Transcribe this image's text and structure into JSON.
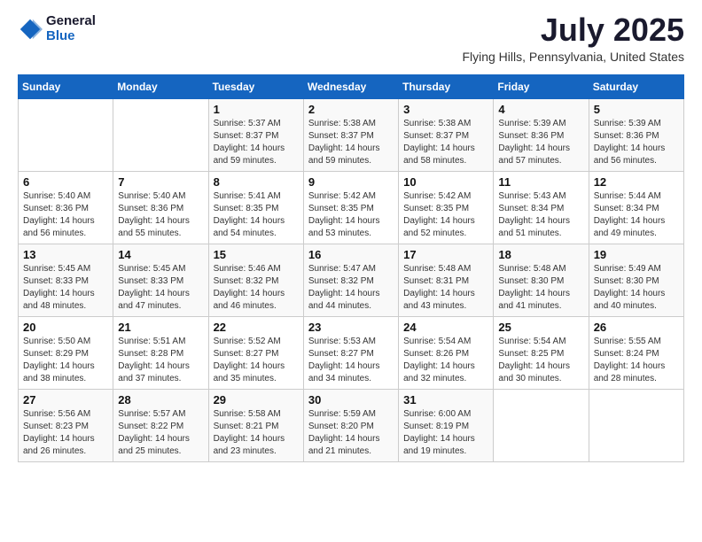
{
  "header": {
    "logo_general": "General",
    "logo_blue": "Blue",
    "month_year": "July 2025",
    "location": "Flying Hills, Pennsylvania, United States"
  },
  "weekdays": [
    "Sunday",
    "Monday",
    "Tuesday",
    "Wednesday",
    "Thursday",
    "Friday",
    "Saturday"
  ],
  "weeks": [
    [
      {
        "day": "",
        "content": ""
      },
      {
        "day": "",
        "content": ""
      },
      {
        "day": "1",
        "content": "Sunrise: 5:37 AM\nSunset: 8:37 PM\nDaylight: 14 hours and 59 minutes."
      },
      {
        "day": "2",
        "content": "Sunrise: 5:38 AM\nSunset: 8:37 PM\nDaylight: 14 hours and 59 minutes."
      },
      {
        "day": "3",
        "content": "Sunrise: 5:38 AM\nSunset: 8:37 PM\nDaylight: 14 hours and 58 minutes."
      },
      {
        "day": "4",
        "content": "Sunrise: 5:39 AM\nSunset: 8:36 PM\nDaylight: 14 hours and 57 minutes."
      },
      {
        "day": "5",
        "content": "Sunrise: 5:39 AM\nSunset: 8:36 PM\nDaylight: 14 hours and 56 minutes."
      }
    ],
    [
      {
        "day": "6",
        "content": "Sunrise: 5:40 AM\nSunset: 8:36 PM\nDaylight: 14 hours and 56 minutes."
      },
      {
        "day": "7",
        "content": "Sunrise: 5:40 AM\nSunset: 8:36 PM\nDaylight: 14 hours and 55 minutes."
      },
      {
        "day": "8",
        "content": "Sunrise: 5:41 AM\nSunset: 8:35 PM\nDaylight: 14 hours and 54 minutes."
      },
      {
        "day": "9",
        "content": "Sunrise: 5:42 AM\nSunset: 8:35 PM\nDaylight: 14 hours and 53 minutes."
      },
      {
        "day": "10",
        "content": "Sunrise: 5:42 AM\nSunset: 8:35 PM\nDaylight: 14 hours and 52 minutes."
      },
      {
        "day": "11",
        "content": "Sunrise: 5:43 AM\nSunset: 8:34 PM\nDaylight: 14 hours and 51 minutes."
      },
      {
        "day": "12",
        "content": "Sunrise: 5:44 AM\nSunset: 8:34 PM\nDaylight: 14 hours and 49 minutes."
      }
    ],
    [
      {
        "day": "13",
        "content": "Sunrise: 5:45 AM\nSunset: 8:33 PM\nDaylight: 14 hours and 48 minutes."
      },
      {
        "day": "14",
        "content": "Sunrise: 5:45 AM\nSunset: 8:33 PM\nDaylight: 14 hours and 47 minutes."
      },
      {
        "day": "15",
        "content": "Sunrise: 5:46 AM\nSunset: 8:32 PM\nDaylight: 14 hours and 46 minutes."
      },
      {
        "day": "16",
        "content": "Sunrise: 5:47 AM\nSunset: 8:32 PM\nDaylight: 14 hours and 44 minutes."
      },
      {
        "day": "17",
        "content": "Sunrise: 5:48 AM\nSunset: 8:31 PM\nDaylight: 14 hours and 43 minutes."
      },
      {
        "day": "18",
        "content": "Sunrise: 5:48 AM\nSunset: 8:30 PM\nDaylight: 14 hours and 41 minutes."
      },
      {
        "day": "19",
        "content": "Sunrise: 5:49 AM\nSunset: 8:30 PM\nDaylight: 14 hours and 40 minutes."
      }
    ],
    [
      {
        "day": "20",
        "content": "Sunrise: 5:50 AM\nSunset: 8:29 PM\nDaylight: 14 hours and 38 minutes."
      },
      {
        "day": "21",
        "content": "Sunrise: 5:51 AM\nSunset: 8:28 PM\nDaylight: 14 hours and 37 minutes."
      },
      {
        "day": "22",
        "content": "Sunrise: 5:52 AM\nSunset: 8:27 PM\nDaylight: 14 hours and 35 minutes."
      },
      {
        "day": "23",
        "content": "Sunrise: 5:53 AM\nSunset: 8:27 PM\nDaylight: 14 hours and 34 minutes."
      },
      {
        "day": "24",
        "content": "Sunrise: 5:54 AM\nSunset: 8:26 PM\nDaylight: 14 hours and 32 minutes."
      },
      {
        "day": "25",
        "content": "Sunrise: 5:54 AM\nSunset: 8:25 PM\nDaylight: 14 hours and 30 minutes."
      },
      {
        "day": "26",
        "content": "Sunrise: 5:55 AM\nSunset: 8:24 PM\nDaylight: 14 hours and 28 minutes."
      }
    ],
    [
      {
        "day": "27",
        "content": "Sunrise: 5:56 AM\nSunset: 8:23 PM\nDaylight: 14 hours and 26 minutes."
      },
      {
        "day": "28",
        "content": "Sunrise: 5:57 AM\nSunset: 8:22 PM\nDaylight: 14 hours and 25 minutes."
      },
      {
        "day": "29",
        "content": "Sunrise: 5:58 AM\nSunset: 8:21 PM\nDaylight: 14 hours and 23 minutes."
      },
      {
        "day": "30",
        "content": "Sunrise: 5:59 AM\nSunset: 8:20 PM\nDaylight: 14 hours and 21 minutes."
      },
      {
        "day": "31",
        "content": "Sunrise: 6:00 AM\nSunset: 8:19 PM\nDaylight: 14 hours and 19 minutes."
      },
      {
        "day": "",
        "content": ""
      },
      {
        "day": "",
        "content": ""
      }
    ]
  ]
}
